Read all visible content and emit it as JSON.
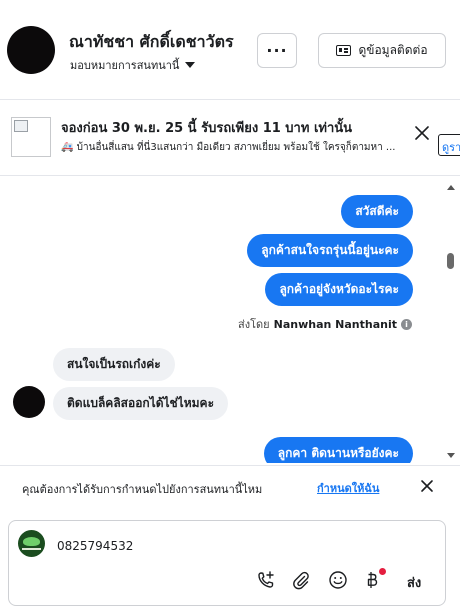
{
  "header": {
    "contact_name": "ณาทัชชา ศักดิ์เดชาวัตร",
    "assign_label": "มอบหมายการสนทนานี้",
    "more_label": "···",
    "contact_info_label": "ดูข้อมูลติดต่อ"
  },
  "ad": {
    "title": "จองก่อน 30 พ.ย. 25 นี้ รับรถเพียง 11 บาท เท่านั้น",
    "van_icon": "🚑",
    "description": "บ้านอื่นสี่แสน ที่นี่3แสนกว่า มือเดียว สภาพเยี่ยม พร้อมใช้ ใครจุก็ตามหา ...",
    "link_label": "ดูรา"
  },
  "messages": [
    {
      "direction": "out",
      "text": "สวัสดีค่ะ"
    },
    {
      "direction": "out",
      "text": "ลูกค้าสนใจรถรุ่นนี้อยู่นะคะ"
    },
    {
      "direction": "out",
      "text": "ลูกค้าอยู่จังหวัดอะไรคะ"
    },
    {
      "direction": "in",
      "text": "สนใจเป็นรถเก๋งค่ะ"
    },
    {
      "direction": "in",
      "text": "ติดแบล็คลิสออกได้ไช่ไหมคะ"
    },
    {
      "direction": "out",
      "text": "ลูกคา  ติดนานหรือยังคะ"
    }
  ],
  "sent_by": {
    "prefix": "ส่งโดย",
    "name": "Nanwhan Nanthanit",
    "info_icon": "i"
  },
  "notice": {
    "text": "คุณต้องการได้รับการกำหนดไปยังการสนทนานี้ไหม",
    "link": "กำหนดให้ฉัน"
  },
  "composer": {
    "text": "0825794532",
    "send_label": "ส่ง",
    "tools": [
      "add-contact-icon",
      "paperclip-icon",
      "emoji-icon",
      "baht-icon"
    ]
  },
  "colors": {
    "accent": "#1877f2",
    "incoming_bubble": "#eff1f4",
    "notification_dot": "#e41e3f"
  }
}
